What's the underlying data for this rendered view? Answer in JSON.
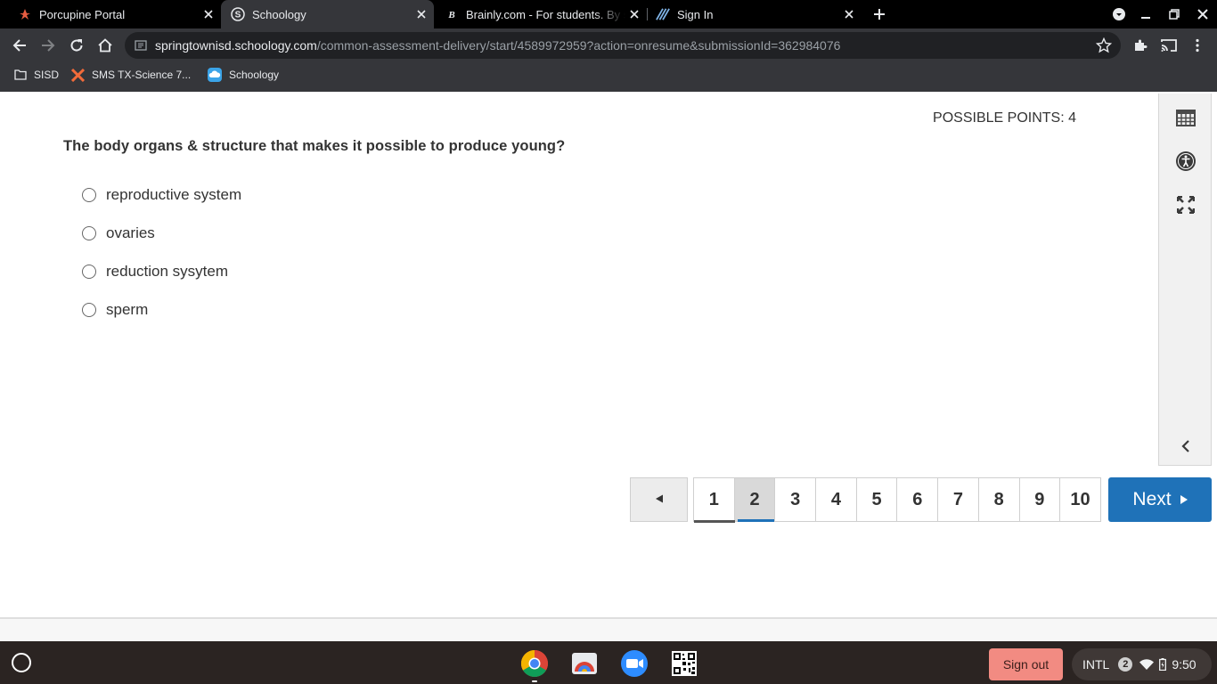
{
  "browser": {
    "tabs": [
      {
        "title": "Porcupine Portal",
        "icon": "porcupine-portal-icon",
        "active": false
      },
      {
        "title": "Schoology",
        "icon": "schoology-icon",
        "active": true
      },
      {
        "title": "Brainly.com - For students. By students.",
        "icon": "brainly-icon",
        "active": false
      },
      {
        "title": "Sign In",
        "icon": "sign-in-icon",
        "active": false
      }
    ],
    "url_host": "springtownisd.schoology.com",
    "url_path": "/common-assessment-delivery/start/4589972959?action=onresume&submissionId=362984076",
    "bookmarks": [
      {
        "label": "SISD",
        "icon": "folder-icon"
      },
      {
        "label": "SMS TX-Science 7...",
        "icon": "x-logo-icon"
      },
      {
        "label": "Schoology",
        "icon": "schoology-cloud-icon"
      }
    ]
  },
  "assessment": {
    "possible_points": "POSSIBLE POINTS: 4",
    "question": "The body organs & structure that makes it possible to produce young?",
    "options": [
      {
        "label": "reproductive system",
        "selected": false
      },
      {
        "label": "ovaries",
        "selected": false
      },
      {
        "label": "reduction sysytem",
        "selected": false
      },
      {
        "label": "sperm",
        "selected": false
      }
    ],
    "pager": {
      "prev_icon": "triangle-left-icon",
      "pages": [
        "1",
        "2",
        "3",
        "4",
        "5",
        "6",
        "7",
        "8",
        "9",
        "10"
      ],
      "current_page": "2",
      "next_label": "Next"
    },
    "side_tools": [
      "calendar-icon",
      "accessibility-icon",
      "fullscreen-icon",
      "collapse-left-icon"
    ]
  },
  "shelf": {
    "apps": [
      "chrome-icon",
      "photos-icon",
      "zoom-icon",
      "qr-code-icon"
    ],
    "signout_label": "Sign out",
    "ime": "INTL",
    "notification_count": "2",
    "time": "9:50"
  },
  "colors": {
    "accent": "#1f72b8",
    "signout": "#f28b82",
    "chrome_dark": "#35363a"
  }
}
